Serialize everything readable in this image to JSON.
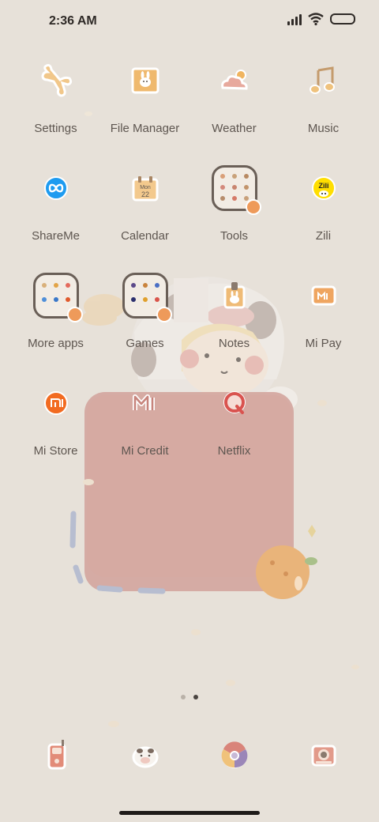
{
  "status_bar": {
    "time": "2:36 AM",
    "icons": [
      "signal-icon",
      "wifi-icon",
      "battery-icon"
    ]
  },
  "apps": [
    {
      "label": "Settings",
      "icon": "bone-settings-icon"
    },
    {
      "label": "File Manager",
      "icon": "folder-bunny-icon"
    },
    {
      "label": "Weather",
      "icon": "cloud-sun-icon"
    },
    {
      "label": "Music",
      "icon": "music-note-icon"
    },
    {
      "label": "ShareMe",
      "icon": "infinity-share-icon"
    },
    {
      "label": "Calendar",
      "icon": "calendar-icon",
      "calendar_text": "Mon",
      "calendar_day": "22"
    },
    {
      "label": "Tools",
      "icon": "tools-folder-icon"
    },
    {
      "label": "Zili",
      "icon": "zili-icon",
      "icon_text": "Zili"
    },
    {
      "label": "More apps",
      "icon": "more-apps-folder-icon"
    },
    {
      "label": "Games",
      "icon": "games-folder-icon"
    },
    {
      "label": "Notes",
      "icon": "notes-clip-icon"
    },
    {
      "label": "Mi Pay",
      "icon": "mi-pay-wallet-icon"
    },
    {
      "label": "Mi Store",
      "icon": "mi-store-icon"
    },
    {
      "label": "Mi Credit",
      "icon": "mi-credit-icon"
    },
    {
      "label": "Netflix",
      "icon": "netflix-icon"
    }
  ],
  "dock": [
    {
      "name": "phone",
      "icon": "walkie-phone-icon"
    },
    {
      "name": "messages",
      "icon": "cow-messages-icon"
    },
    {
      "name": "browser",
      "icon": "chrome-browser-icon"
    },
    {
      "name": "camera",
      "icon": "camera-icon"
    }
  ],
  "page_indicator": {
    "pages": 2,
    "current": 2
  },
  "colors": {
    "background": "#e7e1d9",
    "label": "#5e5650",
    "widget_pink": "#d3a59d",
    "accent_orange": "#ee9a5a",
    "mi_orange": "#f26b21"
  }
}
